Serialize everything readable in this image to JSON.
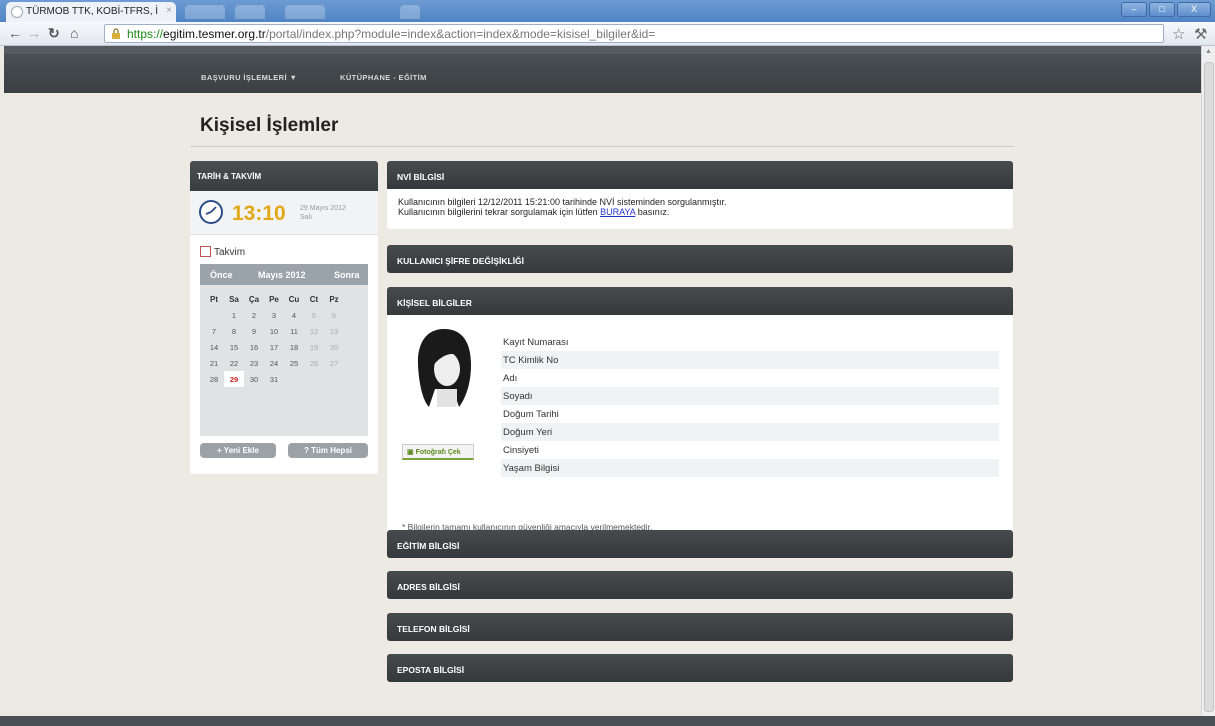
{
  "browser": {
    "tab_title": "TÜRMOB TTK, KOBİ-TFRS, İ",
    "tab_close": "×",
    "url_scheme": "https://",
    "url_host": "egitim.tesmer.org.tr",
    "url_path": "/portal/index.php?module=index&action=index&mode=kisisel_bilgiler&id=",
    "window_buttons": [
      "–",
      "□",
      "X"
    ]
  },
  "topnav": {
    "items": [
      "BAŞVURU İŞLEMLERİ ▼",
      "KÜTÜPHANE - EĞİTİM"
    ]
  },
  "page": {
    "title": "Kişisel İşlemler"
  },
  "sidebar": {
    "header": "TARİH & TAKVİM",
    "time": "13:10",
    "date_line1": "29 Mayıs 2012",
    "date_line2": "Salı",
    "calendar_label": "Takvim",
    "calendar": {
      "prev": "Önce",
      "month": "Mayıs 2012",
      "next": "Sonra",
      "weekdays": [
        "Pt",
        "Sa",
        "Ça",
        "Pe",
        "Cu",
        "Ct",
        "Pz"
      ],
      "weeks": [
        [
          "",
          "1",
          "2",
          "3",
          "4",
          "5",
          "6"
        ],
        [
          "7",
          "8",
          "9",
          "10",
          "11",
          "12",
          "13"
        ],
        [
          "14",
          "15",
          "16",
          "17",
          "18",
          "19",
          "20"
        ],
        [
          "21",
          "22",
          "23",
          "24",
          "25",
          "26",
          "27"
        ],
        [
          "28",
          "29",
          "30",
          "31",
          "",
          "",
          ""
        ]
      ],
      "today": "29"
    },
    "add_button": "+ Yeni Ekle",
    "all_button": "? Tüm Hepsi"
  },
  "panels": {
    "nvi": {
      "title": "NVİ BİLGİSİ",
      "line1": "Kullanıcının bilgileri 12/12/2011 15:21:00 tarihinde NVİ sisteminden sorgulanmıştır.",
      "line2_before": "Kullanıcının bilgilerini tekrar sorgulamak için lütfen ",
      "line2_link": "BURAYA",
      "line2_after": " basınız."
    },
    "password": {
      "title": "KULLANICI ŞİFRE DEĞİŞİKLİĞİ"
    },
    "personal": {
      "title": "KİŞİSEL BİLGİLER",
      "photo_button": "Fotoğrafı Çek",
      "fields": [
        "Kayıt Numarası",
        "TC Kimlik No",
        "Adı",
        "Soyadı",
        "Doğum Tarihi",
        "Doğum Yeri",
        "Cinsiyeti",
        "Yaşam Bilgisi"
      ],
      "footnote": "* Bilgilerin tamamı kullanıcının güvenliği amacıyla verilmemektedir."
    },
    "education": {
      "title": "EĞİTİM BİLGİSİ"
    },
    "address": {
      "title": "ADRES BİLGİSİ"
    },
    "phone": {
      "title": "TELEFON BİLGİSİ"
    },
    "email": {
      "title": "EPOSTA BİLGİSİ"
    }
  },
  "colors": {
    "clock_accent": "#e2a817",
    "panel_header": "#3d4144",
    "link": "#2233cc"
  }
}
